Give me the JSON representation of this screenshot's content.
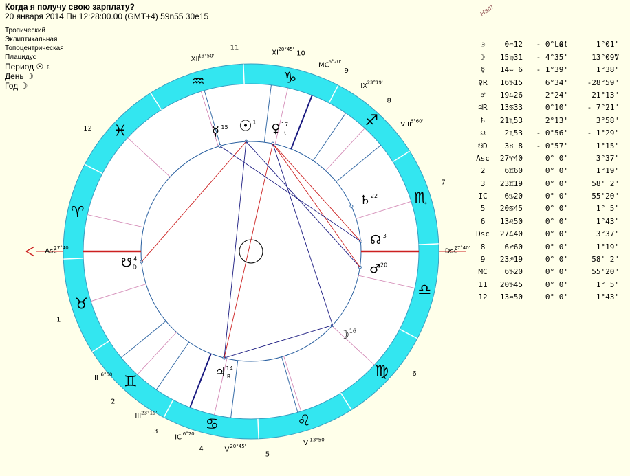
{
  "header": {
    "title": "Когда я получу свою зарплату?",
    "subtitle": "20 января 2014  Пн  12:28:00.00 (GMT+4) 59n55  30e15"
  },
  "params": {
    "zodiac": "Тропический",
    "ecliptic": "Эклиптикальная",
    "topo": "Топоцентрическая",
    "houses": "Плацидус",
    "period_label": "Период",
    "period_rulers": "☉ ♄",
    "day_label": "День",
    "day_ruler": "☽",
    "year_label": "Год",
    "year_ruler": "☽"
  },
  "table": {
    "nat_label": "Нат",
    "col_lat": "Lat",
    "col_v": "V",
    "rows": [
      {
        "sym": "☉",
        "pos": "0♒12",
        "lat": "- 0° 0'",
        "spd": "1°01'"
      },
      {
        "sym": "☽",
        "pos": "15♍31",
        "lat": "- 4°35'",
        "spd": "13°09'"
      },
      {
        "sym": "☿",
        "pos": "14♒ 6",
        "lat": "- 1°39'",
        "spd": "1°38'"
      },
      {
        "sym": "♀R",
        "pos": "16♑15",
        "lat": "6°34'",
        "spd": "-28°59\""
      },
      {
        "sym": "♂",
        "pos": "19♎26",
        "lat": "2°24'",
        "spd": "21°13\""
      },
      {
        "sym": "♃R",
        "pos": "13♋33",
        "lat": "0°10'",
        "spd": "- 7°21\""
      },
      {
        "sym": "♄",
        "pos": "21♏53",
        "lat": "2°13'",
        "spd": "3°58\""
      },
      {
        "sym": "☊",
        "pos": "2♏53",
        "lat": "- 0°56'",
        "spd": "- 1°29'"
      },
      {
        "sym": "☋D",
        "pos": "3♉ 8",
        "lat": "- 0°57'",
        "spd": "1°15'"
      },
      {
        "sym": "Asc",
        "pos": "27♈40",
        "lat": "0° 0'",
        "spd": "3°37'"
      },
      {
        "sym": "2",
        "pos": "6♊60",
        "lat": "0° 0'",
        "spd": "1°19'"
      },
      {
        "sym": "3",
        "pos": "23♊19",
        "lat": "0° 0'",
        "spd": "58' 2\""
      },
      {
        "sym": "IC",
        "pos": "6♋20",
        "lat": "0° 0'",
        "spd": "55'20\""
      },
      {
        "sym": "5",
        "pos": "20♋45",
        "lat": "0° 0'",
        "spd": "1° 5'"
      },
      {
        "sym": "6",
        "pos": "13♌50",
        "lat": "0° 0'",
        "spd": "1°43'"
      },
      {
        "sym": "Dsc",
        "pos": "27♎40",
        "lat": "0° 0'",
        "spd": "3°37'"
      },
      {
        "sym": "8",
        "pos": "6♐60",
        "lat": "0° 0'",
        "spd": "1°19'"
      },
      {
        "sym": "9",
        "pos": "23♐19",
        "lat": "0° 0'",
        "spd": "58' 2\""
      },
      {
        "sym": "MC",
        "pos": "6♑20",
        "lat": "0° 0'",
        "spd": "55'20\""
      },
      {
        "sym": "11",
        "pos": "20♑45",
        "lat": "0° 0'",
        "spd": "1° 5'"
      },
      {
        "sym": "12",
        "pos": "13♒50",
        "lat": "0° 0'",
        "spd": "1°43'"
      }
    ]
  },
  "chart": {
    "ring_color": "#33e6f0",
    "asc_deg": 27.667,
    "cusps": [
      {
        "label": "Asc",
        "deg_label": "27°40'",
        "lon": 27.667,
        "num": "1"
      },
      {
        "label": "II",
        "deg_label": "6°60'",
        "lon": 67.0,
        "num": "2"
      },
      {
        "label": "III",
        "deg_label": "23°19'",
        "lon": 83.317,
        "num": "3"
      },
      {
        "label": "IC",
        "deg_label": "6°20'",
        "lon": 96.333,
        "num": "4"
      },
      {
        "label": "V",
        "deg_label": "20°45'",
        "lon": 110.75,
        "num": "5"
      },
      {
        "label": "VI",
        "deg_label": "13°50'",
        "lon": 133.833,
        "num": "6"
      },
      {
        "label": "Dsc",
        "deg_label": "27°40'",
        "lon": 207.667,
        "num": "7"
      },
      {
        "label": "VIII",
        "deg_label": "6°60'",
        "lon": 247.0,
        "num": "8"
      },
      {
        "label": "IX",
        "deg_label": "23°19'",
        "lon": 263.317,
        "num": "9"
      },
      {
        "label": "MC",
        "deg_label": "6°20'",
        "lon": 276.333,
        "num": "10"
      },
      {
        "label": "XI",
        "deg_label": "20°45'",
        "lon": 290.75,
        "num": "11"
      },
      {
        "label": "XII",
        "deg_label": "13°50'",
        "lon": 313.833,
        "num": "12"
      }
    ],
    "signs": [
      "♈",
      "♉",
      "♊",
      "♋",
      "♌",
      "♍",
      "♎",
      "♏",
      "♐",
      "♑",
      "♒",
      "♓"
    ],
    "planets": [
      {
        "name": "sun",
        "glyph": "☉",
        "num": "1",
        "lon": 300.2,
        "big": true
      },
      {
        "name": "mercury",
        "glyph": "☿",
        "num": "15",
        "lon": 314.1
      },
      {
        "name": "venus",
        "glyph": "♀",
        "num": "17",
        "sub": "R",
        "lon": 286.25
      },
      {
        "name": "saturn",
        "glyph": "♄",
        "num": "22",
        "lon": 231.9
      },
      {
        "name": "north-node",
        "glyph": "☊",
        "num": "3",
        "lon": 212.9
      },
      {
        "name": "mars",
        "glyph": "♂",
        "num": "20",
        "lon": 199.4
      },
      {
        "name": "moon",
        "glyph": "☽",
        "num": "16",
        "lon": 165.5
      },
      {
        "name": "jupiter",
        "glyph": "♃",
        "num": "14",
        "sub": "R",
        "lon": 103.55
      },
      {
        "name": "south-node",
        "glyph": "☋",
        "num": "4",
        "sub": "D",
        "lon": 33.1
      }
    ],
    "aspects": [
      {
        "a": "sun",
        "b": "south-node",
        "color": "#cc2020"
      },
      {
        "a": "sun",
        "b": "mars",
        "color": "#1a1a80"
      },
      {
        "a": "sun",
        "b": "jupiter",
        "color": "#1a1a80"
      },
      {
        "a": "venus",
        "b": "jupiter",
        "color": "#cc2020"
      },
      {
        "a": "venus",
        "b": "north-node",
        "color": "#cc2020"
      },
      {
        "a": "venus",
        "b": "mars",
        "color": "#cc2020"
      },
      {
        "a": "venus",
        "b": "moon",
        "color": "#1a1a80"
      },
      {
        "a": "mercury",
        "b": "north-node",
        "color": "#1a1a80"
      },
      {
        "a": "jupiter",
        "b": "moon",
        "color": "#1a1a80"
      }
    ]
  }
}
